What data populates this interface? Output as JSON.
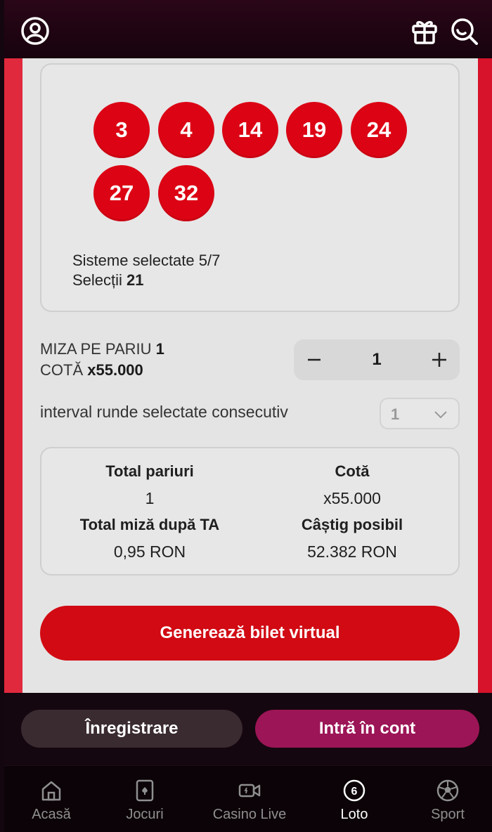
{
  "header": {
    "account_icon": "user-circle-icon",
    "gift_icon": "gift-icon",
    "search_icon": "search-icon"
  },
  "selection": {
    "numbers": [
      "3",
      "4",
      "14",
      "19",
      "24",
      "27",
      "32"
    ],
    "systems_label": "Sisteme selectate 5/7",
    "selections_prefix": "Selecții",
    "selections_value": "21"
  },
  "stake": {
    "miza_label": "MIZA PE PARIU",
    "miza_value": "1",
    "cota_label": "COTĂ",
    "cota_value": "x55.000",
    "stepper_value": "1"
  },
  "interval": {
    "label": "interval runde selectate consecutiv",
    "selected": "1"
  },
  "summary": {
    "total_bets_label": "Total pariuri",
    "total_bets_value": "1",
    "odds_label": "Cotă",
    "odds_value": "x55.000",
    "total_stake_label": "Total miză după TA",
    "total_stake_value": "0,95 RON",
    "win_label": "Câștig posibil",
    "win_value": "52.382 RON"
  },
  "cta_label": "Generează bilet virtual",
  "auth": {
    "register_label": "Înregistrare",
    "login_label": "Intră în cont"
  },
  "nav": {
    "items": [
      {
        "label": "Acasă",
        "icon": "home-icon"
      },
      {
        "label": "Jocuri",
        "icon": "cards-icon"
      },
      {
        "label": "Casino Live",
        "icon": "video-camera-icon"
      },
      {
        "label": "Loto",
        "icon": "lotto-ball-icon"
      },
      {
        "label": "Sport",
        "icon": "soccer-ball-icon"
      }
    ],
    "active": "Loto"
  },
  "colors": {
    "accent_red": "#d10a13",
    "ball_red": "#dc0414",
    "login_magenta": "#9c1556",
    "register_dark": "#3a2b31",
    "header_bg": "#1f0412"
  }
}
